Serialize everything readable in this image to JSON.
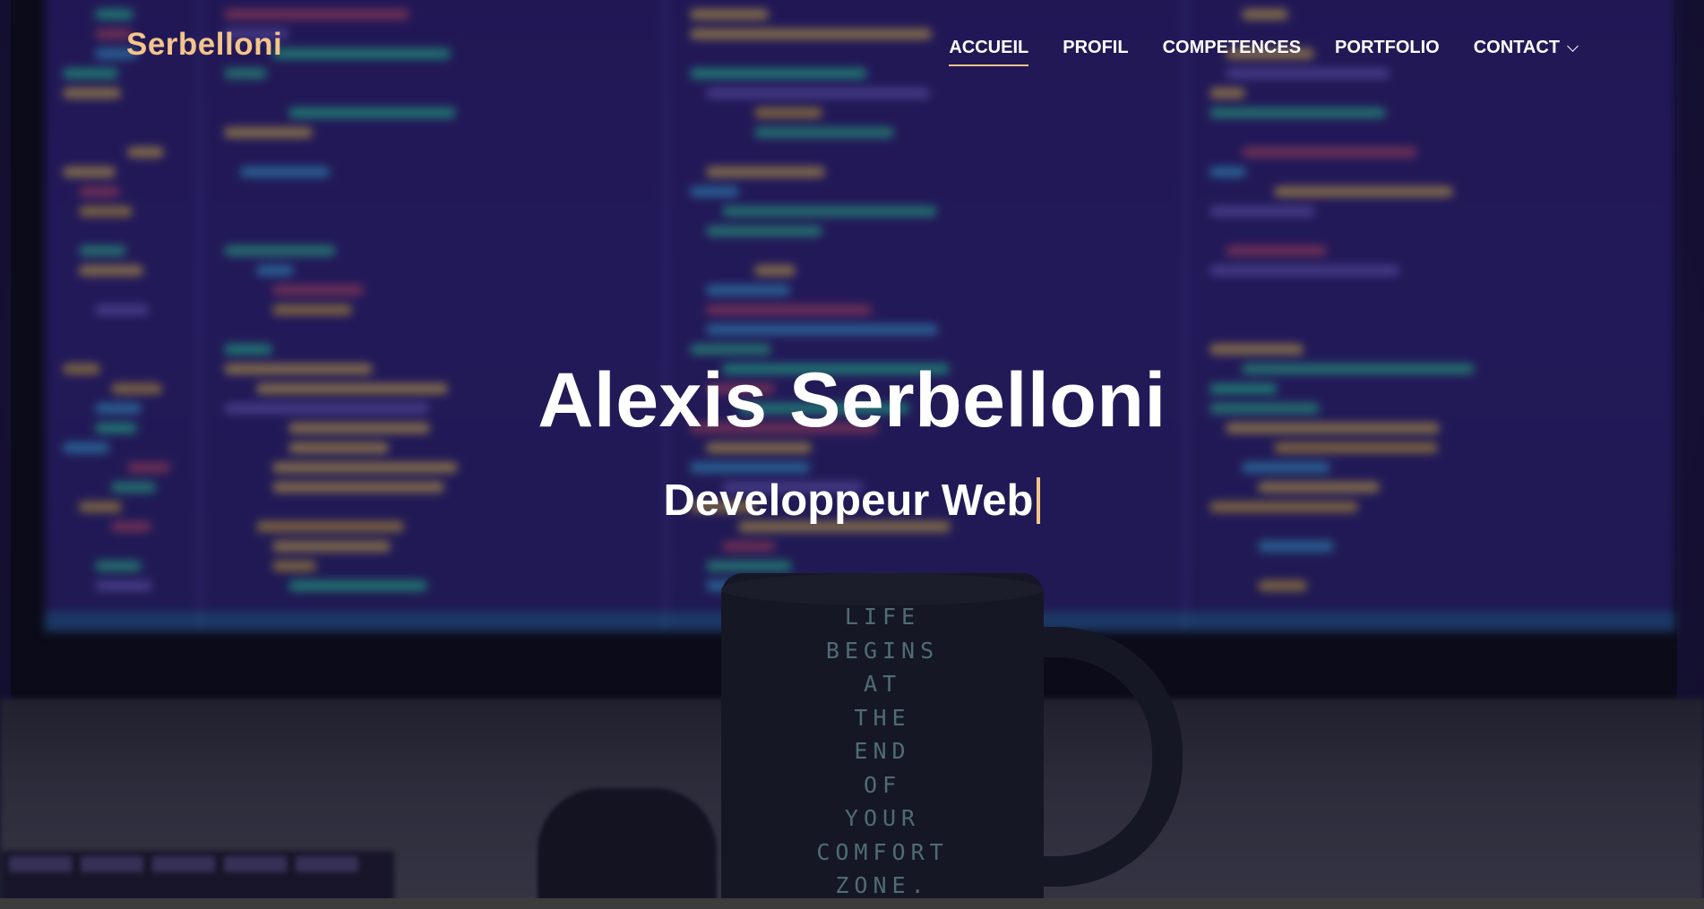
{
  "brand": {
    "logo_text": "Serbelloni",
    "accent_color": "#f4c48a"
  },
  "nav": {
    "items": [
      {
        "label": "ACCUEIL",
        "active": true
      },
      {
        "label": "PROFIL",
        "active": false
      },
      {
        "label": "COMPETENCES",
        "active": false
      },
      {
        "label": "PORTFOLIO",
        "active": false
      },
      {
        "label": "CONTACT",
        "active": false,
        "has_dropdown": true,
        "icon": "chevron-down-icon"
      }
    ]
  },
  "hero": {
    "title": "Alexis Serbelloni",
    "subtitle": "Developpeur Web",
    "cursor_icon": "typed-cursor-icon"
  },
  "background": {
    "mug_text": [
      "LIFE",
      "BEGINS",
      "AT",
      "THE",
      "END",
      "OF",
      "YOUR",
      "COMFORT",
      "ZONE."
    ]
  }
}
